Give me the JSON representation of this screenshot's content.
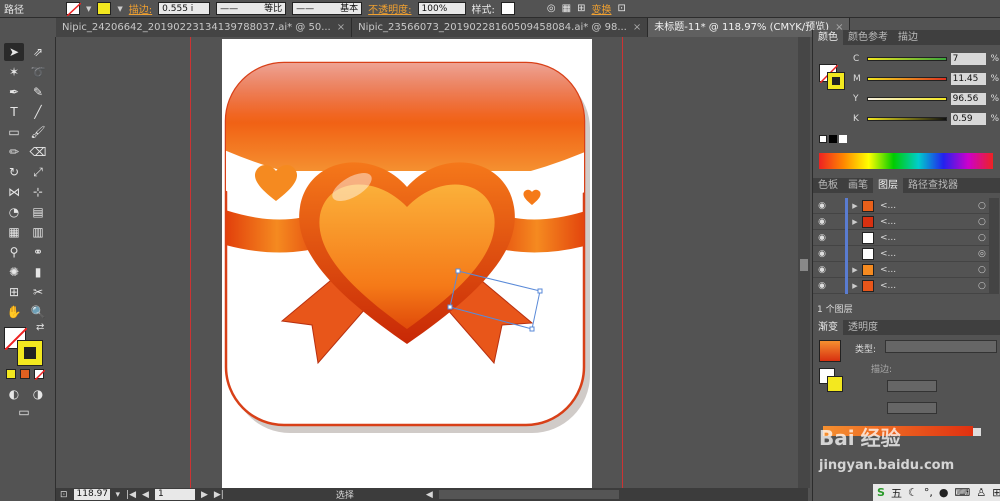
{
  "control_bar": {
    "path_label": "路径",
    "stroke_label": "描边:",
    "stroke_value": "0.555 i",
    "profile_label": "等比",
    "brush_label": "基本",
    "opacity_label": "不透明度:",
    "opacity_value": "100%",
    "style_label": "样式:",
    "transform_label": "变换"
  },
  "tabs": [
    {
      "label": "Nipic_24206642_20190223134139788037.ai* @ 50...",
      "close": "×"
    },
    {
      "label": "Nipic_23566073_20190228160509458084.ai* @ 98...",
      "close": "×"
    },
    {
      "label": "未标题-11* @ 118.97% (CMYK/预览)",
      "close": "×"
    }
  ],
  "color_panel": {
    "tabs": [
      "颜色",
      "颜色参考",
      "描边"
    ],
    "channels": [
      {
        "key": "C",
        "value": "7",
        "unit": "%",
        "level": 0.07
      },
      {
        "key": "M",
        "value": "11.45",
        "unit": "%",
        "level": 0.1145
      },
      {
        "key": "Y",
        "value": "96.56",
        "unit": "%",
        "level": 0.9656
      },
      {
        "key": "K",
        "value": "0.59",
        "unit": "%",
        "level": 0.0059
      }
    ],
    "fill_color": "#f3e81f"
  },
  "layers_panel": {
    "tabs": [
      "色板",
      "画笔",
      "图层",
      "路径查找器"
    ],
    "rows": [
      {
        "name": "<...",
        "has_arrow": true
      },
      {
        "name": "<...",
        "has_arrow": true
      },
      {
        "name": "<...",
        "has_arrow": false
      },
      {
        "name": "<...",
        "has_arrow": false
      },
      {
        "name": "<...",
        "has_arrow": true
      },
      {
        "name": "<...",
        "has_arrow": true
      }
    ],
    "footer": "1 个图层"
  },
  "gradient_panel": {
    "tabs": [
      "渐变",
      "透明度"
    ],
    "type_label": "类型:",
    "stroke_label": "描边:"
  },
  "status": {
    "zoom": "118.97",
    "page": "1",
    "mode": "选择"
  },
  "watermark": {
    "brand": "Bai",
    "brand2": "经验",
    "url": "jingyan.baidu.com"
  },
  "taskbar": {
    "ime_label": "五"
  }
}
